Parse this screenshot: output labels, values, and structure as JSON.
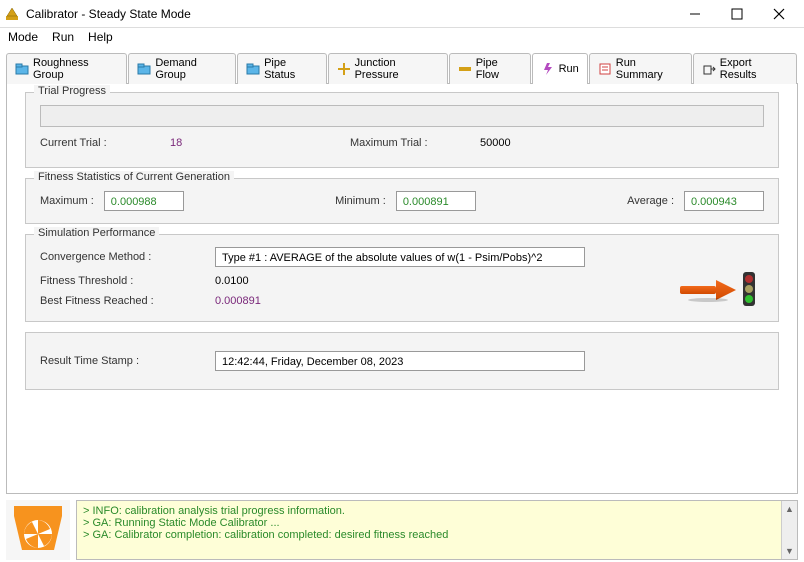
{
  "window": {
    "title": "Calibrator - Steady State Mode"
  },
  "menubar": [
    "Mode",
    "Run",
    "Help"
  ],
  "tabs": [
    {
      "label": "Roughness Group"
    },
    {
      "label": "Demand Group"
    },
    {
      "label": "Pipe Status"
    },
    {
      "label": "Junction Pressure"
    },
    {
      "label": "Pipe Flow"
    },
    {
      "label": "Run",
      "active": true
    },
    {
      "label": "Run Summary"
    },
    {
      "label": "Export Results"
    }
  ],
  "trial_progress": {
    "legend": "Trial Progress",
    "current_label": "Current Trial :",
    "current_value": "18",
    "maximum_label": "Maximum Trial :",
    "maximum_value": "50000"
  },
  "fitness": {
    "legend": "Fitness Statistics of Current Generation",
    "max_label": "Maximum :",
    "max_value": "0.000988",
    "min_label": "Minimum :",
    "min_value": "0.000891",
    "avg_label": "Average :",
    "avg_value": "0.000943"
  },
  "simulation": {
    "legend": "Simulation Performance",
    "convergence_label": "Convergence Method :",
    "convergence_value": "Type #1 :  AVERAGE of the absolute values of w(1 - Psim/Pobs)^2",
    "threshold_label": "Fitness Threshold :",
    "threshold_value": "0.0100",
    "best_label": "Best Fitness Reached :",
    "best_value": "0.000891",
    "timestamp_label": "Result Time Stamp :",
    "timestamp_value": "12:42:44, Friday, December 08, 2023"
  },
  "log": [
    "> INFO: calibration analysis trial progress information.",
    "> GA: Running Static Mode Calibrator ...",
    "> GA: Calibrator completion: calibration completed: desired fitness reached"
  ]
}
